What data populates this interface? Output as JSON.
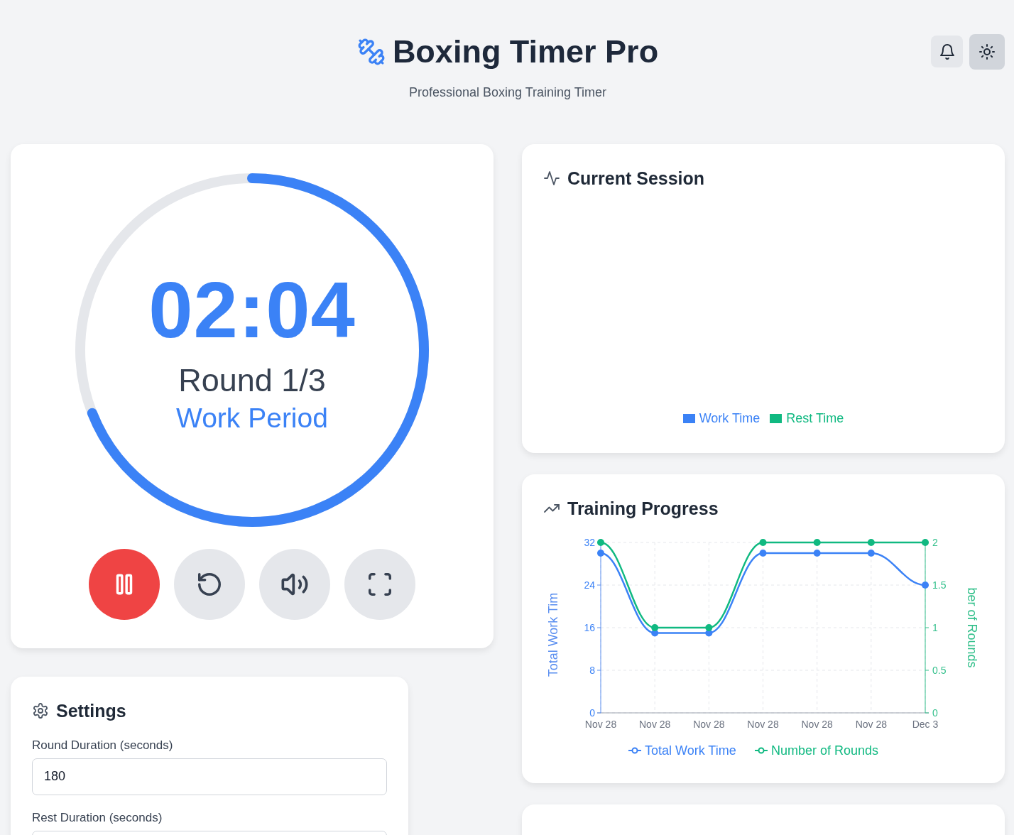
{
  "header": {
    "title": "Boxing Timer Pro",
    "subtitle": "Professional Boxing Training Timer",
    "buttons": [
      {
        "kind": "notifications"
      },
      {
        "kind": "theme"
      }
    ]
  },
  "timer": {
    "time": "02:04",
    "round": "Round 1/3",
    "phase": "Work Period",
    "level": 0.69,
    "controls": [
      {
        "kind": "pause"
      },
      {
        "kind": "reset"
      },
      {
        "kind": "volume"
      },
      {
        "kind": "fullscreen"
      }
    ]
  },
  "settings": {
    "title": "Settings",
    "fields": [
      {
        "label": "Round Duration (seconds)",
        "value": "180"
      },
      {
        "label": "Rest Duration (seconds)"
      }
    ]
  },
  "current_session": {
    "title": "Current Session",
    "legend": [
      {
        "label": "Work Time",
        "color": "#3b82f6"
      },
      {
        "label": "Rest Time",
        "color": "#10b981"
      }
    ]
  },
  "training_progress": {
    "title": "Training Progress",
    "chart_data": {
      "type": "line",
      "ylabel": "Total Work Tim",
      "y2label": "ber of Rounds",
      "categories": [
        "Nov 28",
        "Nov 28",
        "Nov 28",
        "Nov 28",
        "Nov 28",
        "Nov 28",
        "Dec 3"
      ],
      "series": [
        {
          "name": "Total Work Time",
          "color": "#3b82f6",
          "marker": "circle",
          "values": [
            30,
            15,
            15,
            30,
            30,
            30,
            24
          ]
        },
        {
          "name": "Number of Rounds",
          "color": "#10b981",
          "axis": "y2",
          "marker": "circle",
          "values": [
            2,
            1,
            1,
            2,
            2,
            2,
            2
          ]
        }
      ],
      "grid": true,
      "legend": true,
      "ylim": [
        0,
        32
      ],
      "yticks": [
        0,
        8,
        16,
        24,
        32
      ],
      "y2lim": [
        0,
        2
      ],
      "y2ticks": [
        0,
        0.5,
        1,
        1.5,
        2
      ]
    }
  }
}
